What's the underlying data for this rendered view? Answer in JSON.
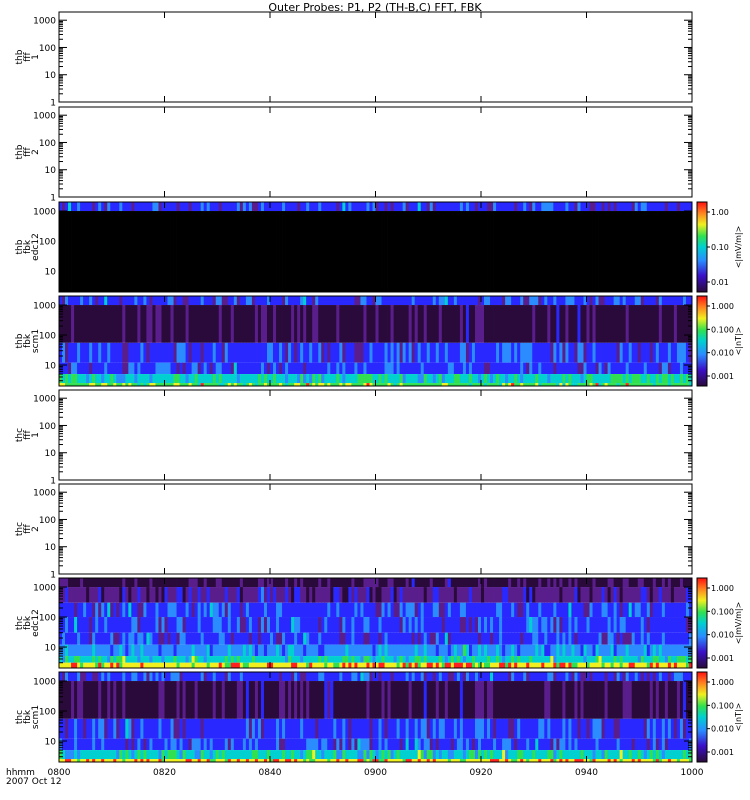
{
  "title": "Outer Probes: P1, P2 (TH-B,C) FFT, FBK",
  "time_axis": {
    "row_label_1": "hhmm",
    "row_label_2": "2007 Oct 12",
    "ticks": [
      "0800",
      "0820",
      "0840",
      "0900",
      "0920",
      "0940",
      "1000"
    ],
    "range_minutes": [
      0,
      120
    ]
  },
  "panel_names": [
    "thb fff 1",
    "thb fff 2",
    "thb fbk edc12",
    "thb fbk scm1",
    "thc fff 1",
    "thc fff 2",
    "thc fbk edc12",
    "thc fbk scm1"
  ],
  "colorbar_values_scm": [
    "1.000",
    "0.100",
    "0.010",
    "0.001"
  ],
  "colorbar_values_edc_thb": [
    "1.00",
    "0.10",
    "0.01"
  ],
  "colorbar_values_edc_thc": [
    "1.000",
    "0.100",
    "0.010",
    "0.001"
  ],
  "colors": {
    "black": "#000000",
    "dark_purple": "#2a0a3a",
    "purple": "#5a1e8c",
    "blue": "#2828ff",
    "light_blue": "#2a8cff",
    "cyan": "#00d0d0",
    "green": "#30e050",
    "yellow": "#f0f020",
    "red": "#ff2020"
  },
  "chart_data": [
    {
      "panel": "thb fff 1",
      "type": "heatmap",
      "ylabel": [
        "thb",
        "fff",
        "1"
      ],
      "yscale": "log",
      "ylim": [
        1,
        2000
      ],
      "yticks": [
        "1",
        "10",
        "100",
        "1000"
      ],
      "colorbar": null,
      "data": "empty"
    },
    {
      "panel": "thb fff 2",
      "type": "heatmap",
      "ylabel": [
        "thb",
        "fff",
        "2"
      ],
      "yscale": "log",
      "ylim": [
        1,
        2000
      ],
      "yticks": [
        "1",
        "10",
        "100",
        "1000"
      ],
      "colorbar": null,
      "data": "empty"
    },
    {
      "panel": "thb fbk edc12",
      "type": "heatmap",
      "ylabel": [
        "thb",
        "fbk",
        "edc12"
      ],
      "yscale": "log",
      "ylim": [
        2,
        2000
      ],
      "yticks": [
        "10",
        "100",
        "1000"
      ],
      "colorbar": {
        "label": "<|mV/m|>",
        "scale": "log",
        "ticks": [
          "1.00",
          "0.10",
          "0.01"
        ]
      },
      "bands": [
        {
          "freq_range": [
            1000,
            2000
          ],
          "level": "blue"
        },
        {
          "freq_range": [
            2,
            1000
          ],
          "level": "black"
        }
      ]
    },
    {
      "panel": "thb fbk scm1",
      "type": "heatmap",
      "ylabel": [
        "thb",
        "fbk",
        "scm1"
      ],
      "yscale": "log",
      "ylim": [
        2,
        2000
      ],
      "yticks": [
        "10",
        "100",
        "1000"
      ],
      "colorbar": {
        "label": "<|nT|>",
        "scale": "log",
        "ticks": [
          "1.000",
          "0.100",
          "0.010",
          "0.001"
        ]
      },
      "bands": [
        {
          "freq_range": [
            1000,
            2000
          ],
          "level": "blue"
        },
        {
          "freq_range": [
            55,
            1000
          ],
          "level": "dark_purple"
        },
        {
          "freq_range": [
            12,
            55
          ],
          "level": "blue"
        },
        {
          "freq_range": [
            5,
            12
          ],
          "level": "blue"
        },
        {
          "freq_range": [
            2.5,
            5
          ],
          "level": "cyan"
        },
        {
          "freq_range": [
            2,
            2.5
          ],
          "level": "green"
        }
      ]
    },
    {
      "panel": "thc fff 1",
      "type": "heatmap",
      "ylabel": [
        "thc",
        "fff",
        "1"
      ],
      "yscale": "log",
      "ylim": [
        1,
        2000
      ],
      "yticks": [
        "1",
        "10",
        "100",
        "1000"
      ],
      "colorbar": null,
      "data": "empty"
    },
    {
      "panel": "thc fff 2",
      "type": "heatmap",
      "ylabel": [
        "thc",
        "fff",
        "2"
      ],
      "yscale": "log",
      "ylim": [
        1,
        2000
      ],
      "yticks": [
        "1",
        "10",
        "100",
        "1000"
      ],
      "colorbar": null,
      "data": "empty"
    },
    {
      "panel": "thc fbk edc12",
      "type": "heatmap",
      "ylabel": [
        "thc",
        "fbk",
        "edc12"
      ],
      "yscale": "log",
      "ylim": [
        2,
        2000
      ],
      "yticks": [
        "10",
        "100",
        "1000"
      ],
      "colorbar": {
        "label": "<|mV/m|>",
        "scale": "log",
        "ticks": [
          "1.000",
          "0.100",
          "0.010",
          "0.001"
        ]
      },
      "bands": [
        {
          "freq_range": [
            1000,
            2000
          ],
          "level": "dark_purple"
        },
        {
          "freq_range": [
            300,
            1000
          ],
          "level": "purple"
        },
        {
          "freq_range": [
            100,
            300
          ],
          "level": "blue"
        },
        {
          "freq_range": [
            30,
            100
          ],
          "level": "blue"
        },
        {
          "freq_range": [
            12,
            30
          ],
          "level": "blue"
        },
        {
          "freq_range": [
            5,
            12
          ],
          "level": "light_blue"
        },
        {
          "freq_range": [
            3,
            5
          ],
          "level": "cyan"
        },
        {
          "freq_range": [
            2,
            3
          ],
          "level": "yellow"
        }
      ]
    },
    {
      "panel": "thc fbk scm1",
      "type": "heatmap",
      "ylabel": [
        "thc",
        "fbk",
        "scm1"
      ],
      "yscale": "log",
      "ylim": [
        2,
        2000
      ],
      "yticks": [
        "10",
        "100",
        "1000"
      ],
      "colorbar": {
        "label": "<|nT|>",
        "scale": "log",
        "ticks": [
          "1.000",
          "0.100",
          "0.010",
          "0.001"
        ]
      },
      "bands": [
        {
          "freq_range": [
            1000,
            2000
          ],
          "level": "blue"
        },
        {
          "freq_range": [
            55,
            1000
          ],
          "level": "dark_purple"
        },
        {
          "freq_range": [
            12,
            55
          ],
          "level": "blue"
        },
        {
          "freq_range": [
            5,
            12
          ],
          "level": "blue"
        },
        {
          "freq_range": [
            2.5,
            5
          ],
          "level": "cyan"
        },
        {
          "freq_range": [
            2,
            2.5
          ],
          "level": "yellow"
        }
      ]
    }
  ]
}
